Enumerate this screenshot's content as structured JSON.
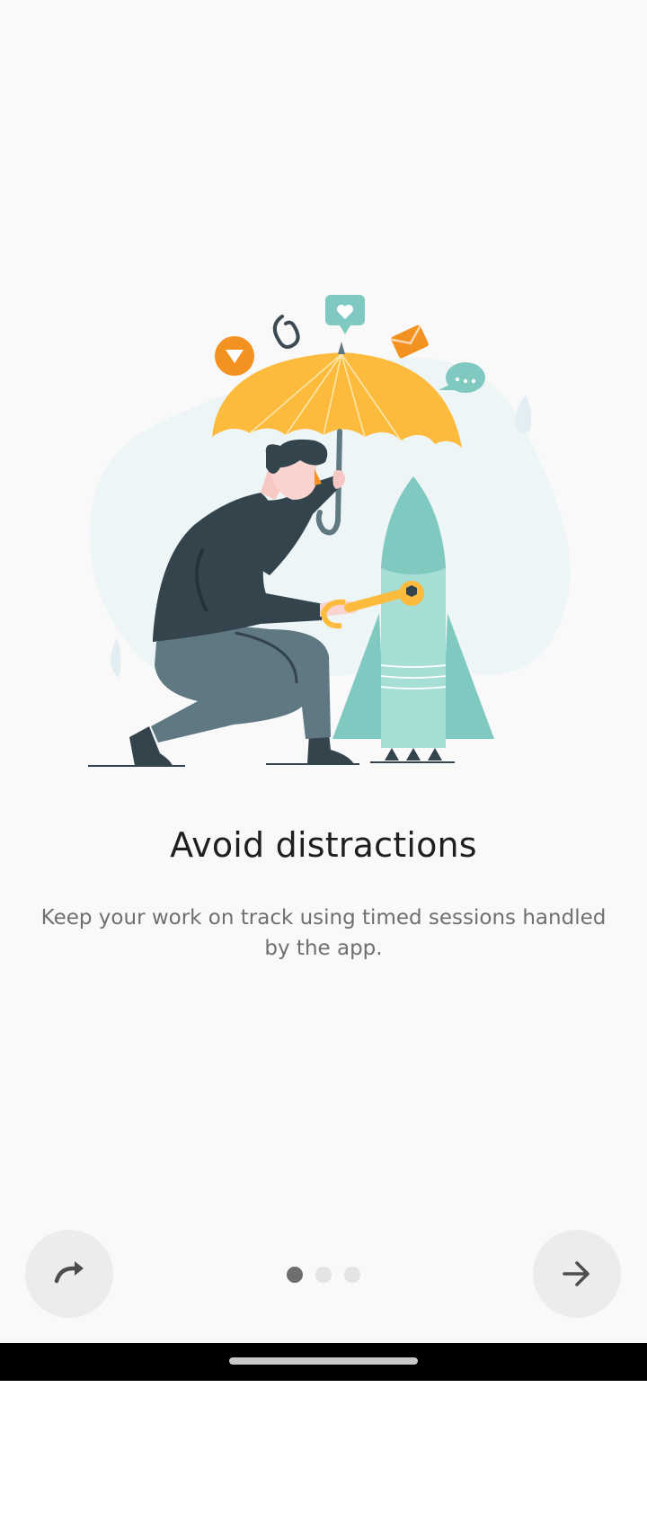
{
  "onboarding": {
    "title": "Avoid distractions",
    "subtitle": "Keep your work on track using timed sessions handled by the app.",
    "current_page": 1,
    "total_pages": 3
  },
  "buttons": {
    "skip_icon": "redo-arrow-icon",
    "next_icon": "arrow-right-icon"
  },
  "colors": {
    "background": "#f9f9f9",
    "umbrella": "#fdbb3d",
    "teal": "#7fc9c0",
    "orange": "#f39220",
    "dark": "#34444d",
    "pants": "#607882"
  }
}
